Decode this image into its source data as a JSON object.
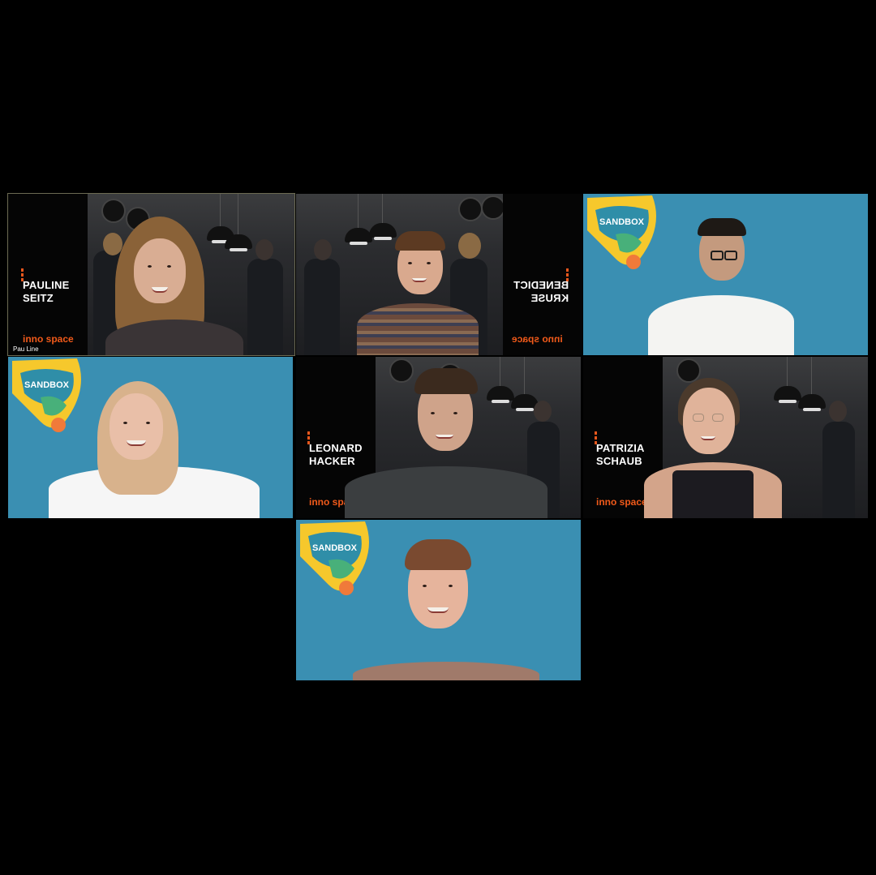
{
  "participants": [
    {
      "name_line1": "PAULINE",
      "name_line2": "SEITZ",
      "caption": "Pau Line",
      "background": "inno space"
    },
    {
      "name_line1": "BENEDICT",
      "name_line2": "KRUSE",
      "background": "inno space"
    },
    {
      "background": "SANDBOX"
    },
    {
      "background": "SANDBOX"
    },
    {
      "name_line1": "LEONARD",
      "name_line2": "HACKER",
      "background": "inno space"
    },
    {
      "name_line1": "PATRIZIA",
      "name_line2": "SCHAUB",
      "background": "inno space"
    },
    {
      "background": "SANDBOX"
    }
  ],
  "brand": {
    "inno_label": "inno space",
    "sandbox_label": "SANDBOX",
    "inno_color": "#f15a1a",
    "sandbox_bg": "#3a8fb2",
    "active_border": "#6b6a52"
  }
}
